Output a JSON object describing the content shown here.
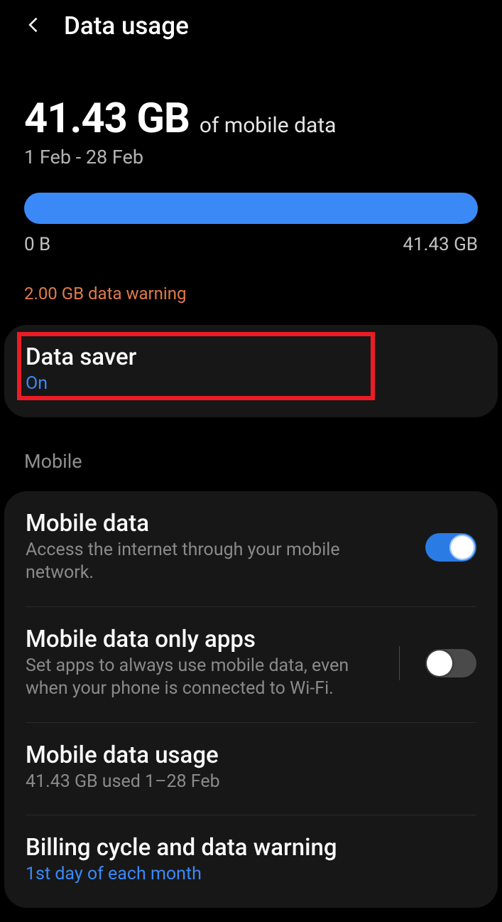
{
  "header": {
    "title": "Data usage"
  },
  "summary": {
    "usage_amount": "41.43 GB",
    "usage_suffix": "of mobile data",
    "period": "1 Feb - 28 Feb",
    "bar_min": "0 B",
    "bar_max": "41.43 GB",
    "warning": "2.00 GB data warning"
  },
  "data_saver": {
    "title": "Data saver",
    "status": "On"
  },
  "mobile": {
    "section_label": "Mobile",
    "data": {
      "title": "Mobile data",
      "desc": "Access the internet through your mobile network.",
      "enabled": true
    },
    "only_apps": {
      "title": "Mobile data only apps",
      "desc": "Set apps to always use mobile data, even when your phone is connected to Wi-Fi.",
      "enabled": false
    },
    "usage": {
      "title": "Mobile data usage",
      "desc": "41.43 GB used 1–28 Feb"
    },
    "billing": {
      "title": "Billing cycle and data warning",
      "desc": "1st day of each month"
    }
  }
}
